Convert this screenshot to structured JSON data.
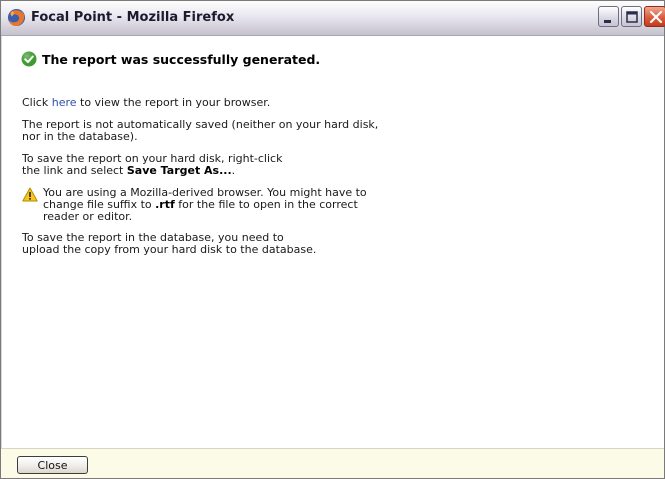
{
  "window": {
    "title": "Focal Point - Mozilla Firefox"
  },
  "message": {
    "heading": "The report was successfully generated.",
    "line1_prefix": "Click ",
    "line1_link": "here",
    "line1_suffix": " to view the report in your browser.",
    "para2_line1": "The report is not automatically saved (neither on your hard disk,",
    "para2_line2": "nor in the database).",
    "para3_line1": "To save the report on your hard disk, right-click",
    "para3_line2_prefix": "the link and select ",
    "para3_line2_bold": "Save Target As...",
    "para3_line2_suffix": ".",
    "warn_line1": "You are using a Mozilla-derived browser. You might have to",
    "warn_line2_prefix": "change file suffix to ",
    "warn_line2_bold": ".rtf",
    "warn_line2_suffix": " for the file to open in the correct",
    "warn_line3": "reader or editor.",
    "para5_line1": "To save the report in the database, you need to",
    "para5_line2": "upload the copy from your hard disk to the database."
  },
  "footer": {
    "close_label": "Close"
  },
  "icons": {
    "app": "firefox-icon",
    "success": "check-circle-icon",
    "warning": "warning-triangle-icon"
  },
  "colors": {
    "link": "#2a4fa8",
    "success": "#3c9a2e",
    "warning": "#f4c81c",
    "footer_bg": "#fbfbe8"
  }
}
